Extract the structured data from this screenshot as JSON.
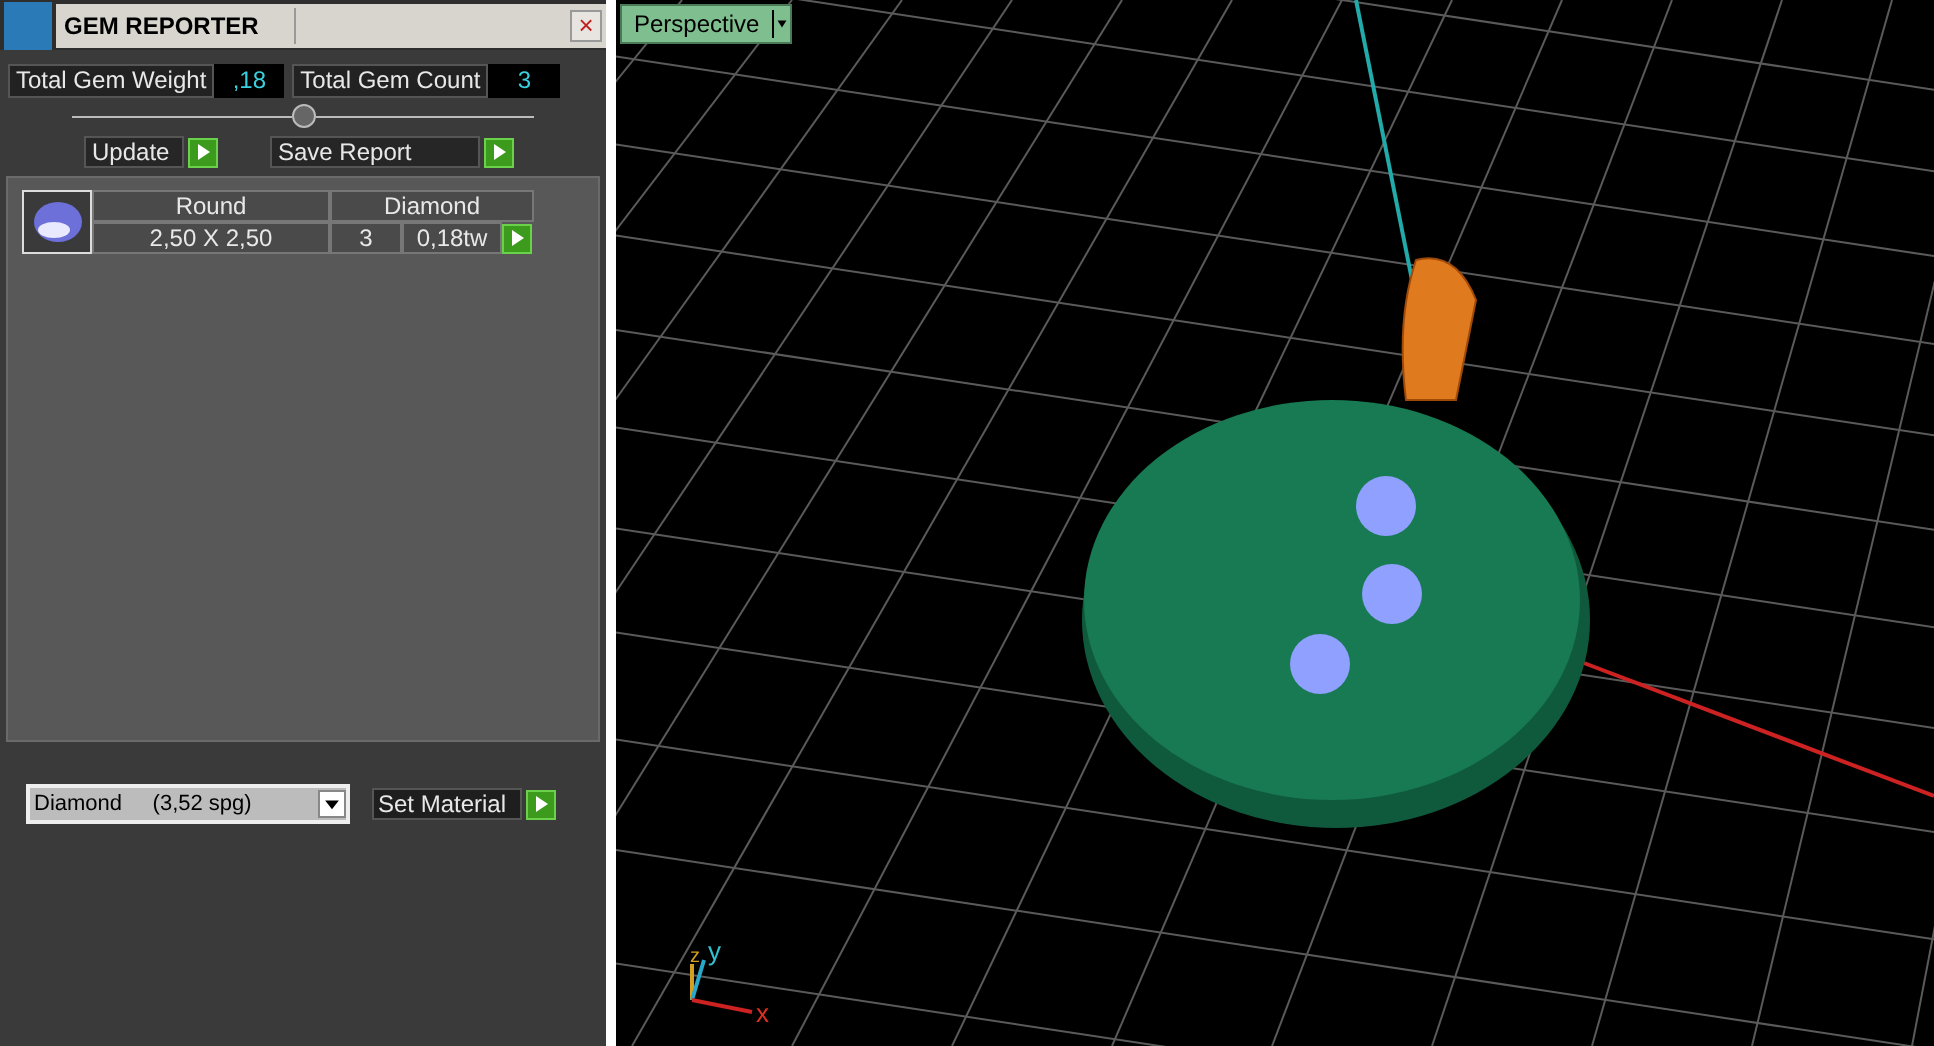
{
  "panel": {
    "title": "GEM REPORTER",
    "close": "×"
  },
  "totals": [
    {
      "label": "Total Gem Weight",
      "value": ",18"
    },
    {
      "label": "Total Gem Count",
      "value": "3"
    }
  ],
  "actions": [
    "Update",
    "Save Report"
  ],
  "gems": [
    {
      "shape": "Round",
      "material": "Diamond",
      "size": "2,50 X 2,50",
      "count": "3",
      "weight": "0,18tw"
    }
  ],
  "material_select": {
    "value": "Diamond     (3,52 spg)"
  },
  "set_material": "Set Material",
  "viewport": {
    "view": "Perspective",
    "axes": [
      "x",
      "y",
      "z"
    ]
  }
}
